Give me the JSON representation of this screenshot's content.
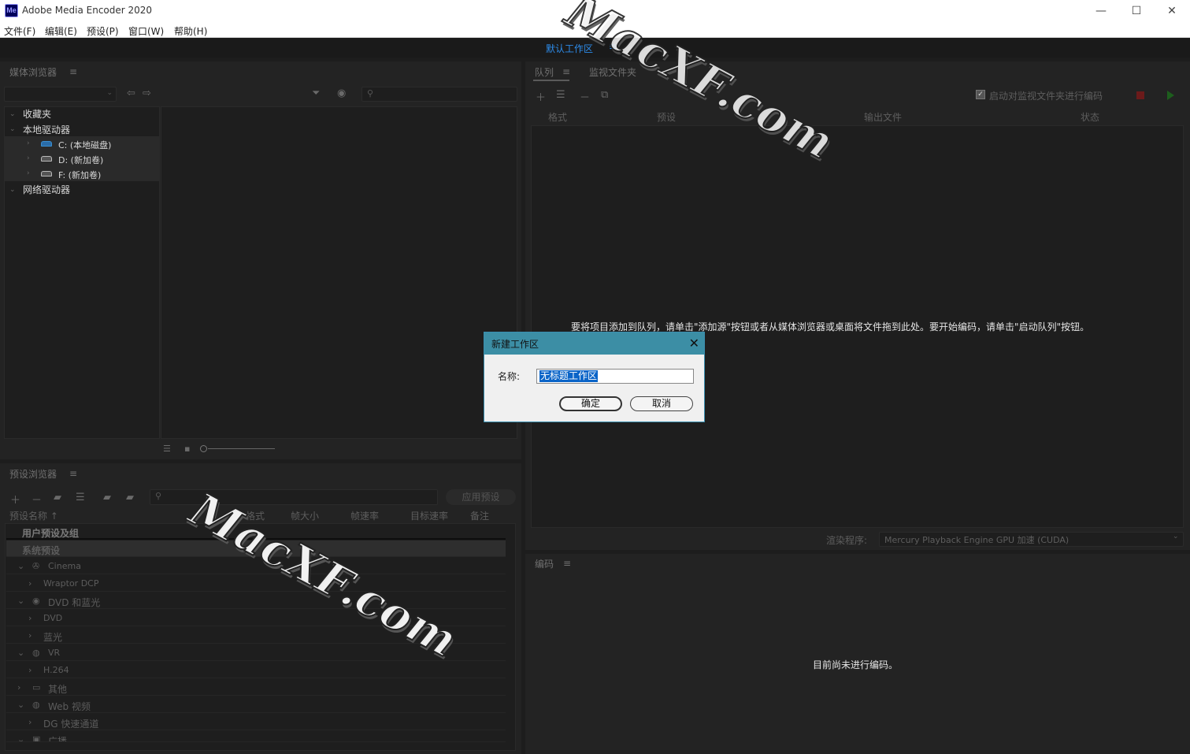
{
  "window": {
    "app_icon_text": "Me",
    "title": "Adobe Media Encoder 2020",
    "minimize": "—",
    "maximize": "☐",
    "close": "✕"
  },
  "menu": [
    "文件(F)",
    "编辑(E)",
    "预设(P)",
    "窗口(W)",
    "帮助(H)"
  ],
  "workspace": {
    "name": "默认工作区",
    "menu_glyph": "≡"
  },
  "media_browser": {
    "title": "媒体浏览器",
    "tree": {
      "favorites": "收藏夹",
      "local_drives": "本地驱动器",
      "drives": [
        "C: (本地磁盘)",
        "D: (新加卷)",
        "F: (新加卷)"
      ],
      "network_drives": "网络驱动器"
    }
  },
  "queue": {
    "tabs": [
      "队列",
      "监视文件夹"
    ],
    "auto_encode_label": "启动对监视文件夹进行编码",
    "columns": [
      "格式",
      "预设",
      "输出文件",
      "状态"
    ],
    "empty_message": "要将项目添加到队列，请单击\"添加源\"按钮或者从媒体浏览器或桌面将文件拖到此处。要开始编码，请单击\"启动队列\"按钮。",
    "renderer_label": "渲染程序:",
    "renderer_value": "Mercury Playback Engine GPU 加速 (CUDA)"
  },
  "preset_browser": {
    "title": "预设浏览器",
    "apply_button": "应用预设",
    "columns": [
      "预设名称 ↑",
      "格式",
      "帧大小",
      "帧速率",
      "目标速率",
      "备注"
    ],
    "rows": [
      {
        "label": "用户预设及组"
      },
      {
        "label": "系统预设"
      },
      {
        "label": "Cinema"
      },
      {
        "label": "Wraptor DCP"
      },
      {
        "label": "DVD 和蓝光"
      },
      {
        "label": "DVD"
      },
      {
        "label": "蓝光"
      },
      {
        "label": "VR"
      },
      {
        "label": "H.264"
      },
      {
        "label": "其他"
      },
      {
        "label": "Web 视频"
      },
      {
        "label": "DG 快速通道"
      },
      {
        "label": "广播"
      }
    ]
  },
  "encoding": {
    "title": "编码",
    "empty_message": "目前尚未进行编码。"
  },
  "dialog": {
    "title": "新建工作区",
    "name_label": "名称:",
    "name_value": "无标题工作区",
    "ok": "确定",
    "cancel": "取消"
  },
  "watermark": {
    "text_top": "MacXF.com",
    "text_main": "MacXF.com"
  },
  "colors": {
    "accent": "#2d8ceb",
    "dialog_title": "#3c8ea5",
    "selection": "#0a64c8",
    "stop": "#b22222",
    "play": "#2aa52a"
  }
}
